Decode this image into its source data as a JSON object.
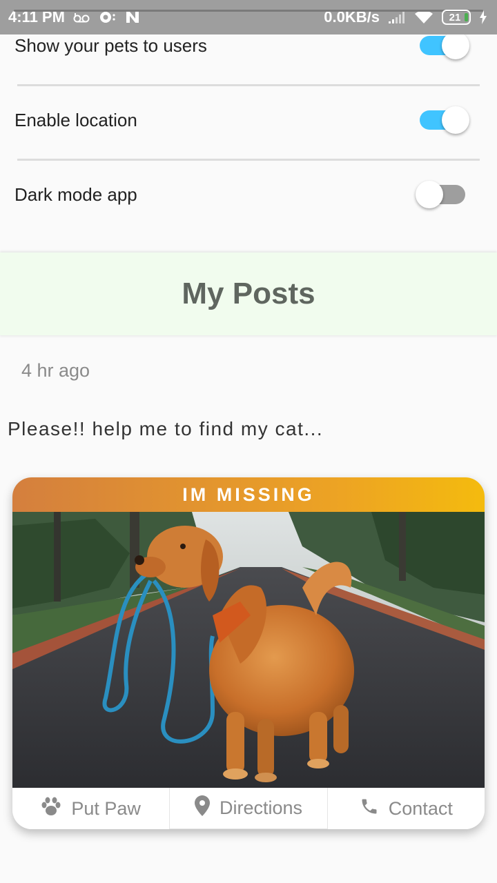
{
  "status_bar": {
    "time": "4:11 PM",
    "network_speed": "0.0KB/s",
    "battery_level": "21",
    "icons": [
      "voicemail-icon",
      "camera-sync-icon",
      "n-app-icon",
      "signal-icon",
      "wifi-icon",
      "battery-icon",
      "charging-icon"
    ]
  },
  "settings": {
    "rows": [
      {
        "label": "Show your pets to users",
        "enabled": true
      },
      {
        "label": "Enable location",
        "enabled": true
      },
      {
        "label": "Dark mode app",
        "enabled": false
      }
    ]
  },
  "posts": {
    "title": "My Posts",
    "items": [
      {
        "time_ago": "4 hr ago",
        "text": "Please!! help me to find my cat...",
        "banner": "IM MISSING",
        "actions": [
          {
            "label": "Put Paw",
            "icon": "paw-icon"
          },
          {
            "label": "Directions",
            "icon": "location-pin-icon"
          },
          {
            "label": "Contact",
            "icon": "phone-icon"
          }
        ]
      }
    ]
  },
  "colors": {
    "toggle_on": "#40c4ff",
    "toggle_off": "#9e9e9e",
    "posts_header_bg": "#f1fcee",
    "banner_start": "#d47f3e",
    "banner_end": "#f4bb0e"
  }
}
